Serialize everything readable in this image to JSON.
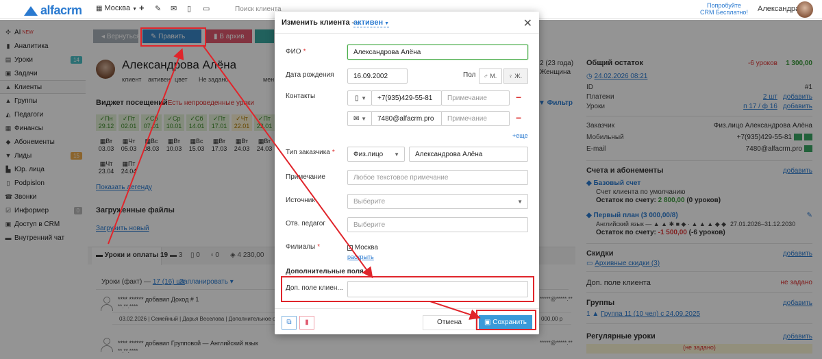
{
  "topbar": {
    "logo": "alfacrm",
    "city": "Москва",
    "search_placeholder": "Поиск клиента",
    "promo_line1": "Попробуйте",
    "promo_line2": "CRM Бесплатно!",
    "user": "Александра"
  },
  "sidebar": {
    "items": [
      {
        "icon": "✣",
        "label": "AI",
        "sup": "NEW"
      },
      {
        "icon": "▮",
        "label": "Аналитика"
      },
      {
        "icon": "▤",
        "label": "Уроки",
        "badge": "14",
        "badge_color": "#4bbfc6"
      },
      {
        "icon": "▣",
        "label": "Задачи"
      },
      {
        "icon": "👤",
        "label": "Клиенты"
      },
      {
        "icon": "👥",
        "label": "Группы"
      },
      {
        "icon": "🎓",
        "label": "Педагоги"
      },
      {
        "icon": "▦",
        "label": "Финансы"
      },
      {
        "icon": "◆",
        "label": "Абонементы"
      },
      {
        "icon": "▼",
        "label": "Лиды",
        "badge": "15",
        "badge_color": "#f0ad4e"
      },
      {
        "icon": "▙",
        "label": "Юр. лица"
      },
      {
        "icon": "▯",
        "label": "Podpislon"
      },
      {
        "icon": "☎",
        "label": "Звонки"
      },
      {
        "icon": "☑",
        "label": "Информер",
        "badge": "0",
        "badge_color": "#bbbbbb"
      },
      {
        "icon": "🔒",
        "label": "Доступ в CRM"
      },
      {
        "icon": "▬",
        "label": "Внутренний чат"
      }
    ]
  },
  "main": {
    "btn_return": "Вернуться",
    "btn_edit": "Править",
    "btn_archive": "В архив",
    "client_name": "Александрова Алёна",
    "meta_client": "клиент",
    "meta_status": "активен",
    "meta_color": "цвет",
    "meta_unset": "Не задано",
    "meta_more": "мен",
    "age": "2 (23 года)",
    "gender": "Женщина",
    "widget_title": "Виджет посещений",
    "widget_warn": "Есть непроведенные уроки",
    "filter": "Фильтр",
    "days_row1": [
      {
        "d": "Пн",
        "date": "29.12",
        "c": "g"
      },
      {
        "d": "Пт",
        "date": "02.01",
        "c": "g"
      },
      {
        "d": "Сб",
        "date": "07.01",
        "c": "g"
      },
      {
        "d": "Ср",
        "date": "10.01",
        "c": "g"
      },
      {
        "d": "Сб",
        "date": "14.01",
        "c": "g"
      },
      {
        "d": "Пт",
        "date": "17.01",
        "c": "g"
      },
      {
        "d": "Чт",
        "date": "22.01",
        "c": "y"
      },
      {
        "d": "Пт",
        "date": "23.01",
        "c": "g"
      }
    ],
    "days_row2": [
      {
        "d": "Вт",
        "date": "03.03"
      },
      {
        "d": "Чт",
        "date": "05.03"
      },
      {
        "d": "Вс",
        "date": "08.03"
      },
      {
        "d": "Вт",
        "date": "10.03"
      },
      {
        "d": "Вс",
        "date": "15.03"
      },
      {
        "d": "Вт",
        "date": "17.03"
      },
      {
        "d": "Вт",
        "date": "24.03"
      },
      {
        "d": "Вт",
        "date": "24.03"
      }
    ],
    "days_row3": [
      {
        "d": "Чт",
        "date": "23.04"
      },
      {
        "d": "Пт",
        "date": "24.04"
      }
    ],
    "show_legend": "Показать легенду",
    "files_title": "Загруженные файлы",
    "upload_new": "Загрузить новый",
    "tabs": [
      "Уроки и оплаты 19",
      "3",
      "0",
      "0",
      "4 230,00"
    ],
    "lessons_fact_label": "Уроки (факт) —",
    "lessons_fact_value": "17 (16) шт",
    "scheduled": "Запланировать",
    "feed1_author": "**** ****** добавил Доход # 1",
    "feed1_detail": "03.02.2026 | Семейный | Дарья Веселова | Дополнительное о",
    "feed1_amount": "000,00 р",
    "feed2_author": "**** ****** добавил Групповой — Английский язык",
    "masked1": "**.**.****",
    "masked2": "*****@*****.**"
  },
  "right": {
    "balance_label": "Общий остаток",
    "balance_lessons": "-6 уроков",
    "balance_money": "1 300,00",
    "date": "24.02.2026 08:21",
    "id_label": "ID",
    "id_value": "#1",
    "pay_label": "Платежи",
    "pay_value": "2 шт",
    "add": "добавить",
    "lessons_label": "Уроки",
    "lessons_value": "п 17 / ф 16",
    "customer_label": "Заказчик",
    "customer_value": "Физ.лицо Александрова Алёна",
    "mobile_label": "Мобильный",
    "mobile_value": "+7(935)429-55-81",
    "email_label": "E-mail",
    "email_value": "7480@alfacrm.pro",
    "accounts_title": "Счета и абонементы",
    "base_account": "Базовый счет",
    "base_account_sub": "Счет клиента по умолчанию",
    "base_balance_label": "Остаток по счету:",
    "base_balance_value": "2 800,00",
    "base_balance_lessons": "(0 уроков)",
    "plan_title": "Первый план (3 000,00/8)",
    "plan_sub": "Английский язык — ▲ ▲ ✱ ■ ◆ · ▲ ▲ ▲ ◆ ◆",
    "plan_dates": "27.01.2026–31.12.2030",
    "plan_balance_value": "-1 500,00",
    "plan_balance_lessons": "(-6 уроков)",
    "discounts_title": "Скидки",
    "archived_discounts": "Архивные скидки (3)",
    "extra_title": "Доп. поле клиента",
    "extra_value": "не задано",
    "groups_title": "Группы",
    "group_item": "Группа 11 (10 чел) с 24.09.2025",
    "regular_title": "Регулярные уроки",
    "regular_value": "(не задано)"
  },
  "modal": {
    "title": "Изменить клиента",
    "dash": "—",
    "status": "активен",
    "fio_label": "ФИО",
    "fio_value": "Александрова Алёна",
    "birth_label": "Дата рождения",
    "birth_value": "16.09.2002",
    "sex_label": "Пол",
    "sex_m": "М.",
    "sex_f": "Ж.",
    "contacts_label": "Контакты",
    "phone_value": "+7(935)429-55-81",
    "email_value": "7480@alfacrm.pro",
    "note_placeholder": "Примечание",
    "more_link": "+еще",
    "customer_type_label": "Тип заказчика",
    "customer_type_value": "Физ.лицо",
    "customer_name": "Александрова Алёна",
    "note_label": "Примечание",
    "note_area_placeholder": "Любое текстовое примечание",
    "source_label": "Источник",
    "select_placeholder": "Выберите",
    "teacher_label": "Отв. педагог",
    "branches_label": "Филиалы",
    "branch_value": "Москва",
    "expand_link": "раскрыть",
    "extra_section": "Дополнительные поля",
    "extra_field_label": "Доп. поле клиен...",
    "cancel": "Отмена",
    "save": "Сохранить"
  },
  "colors": {
    "brand": "#2a7ad0",
    "edit_button": "#3a87c8",
    "archive_button": "#e0596f",
    "save_button": "#3a9ad9",
    "highlight": "#e0252b"
  }
}
